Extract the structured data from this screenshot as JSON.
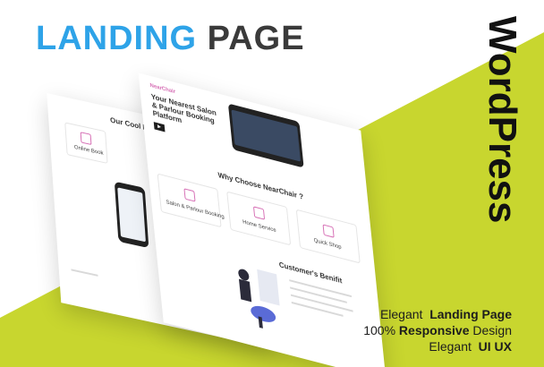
{
  "title": {
    "part1": "LANDING",
    "part2": "PAGE"
  },
  "side_label": "WordPress",
  "tagline": {
    "line1_a": "Elegant",
    "line1_b": "Landing Page",
    "line2_a": "100%",
    "line2_b": "Responsive",
    "line2_c": "Design",
    "line3_a": "Elegant",
    "line3_b": "UI UX"
  },
  "mockup": {
    "back_heading": "Our Cool Features",
    "back_card": "Online Book",
    "hero_title": "Your Nearest Salon & Parlour Booking Platform",
    "hero_brand": "NearChair",
    "why_heading": "Why Choose NearChair ?",
    "cards": [
      "Salon & Parlour Booking",
      "Home Service",
      "Quick Shop"
    ],
    "benefit_heading": "Customer's Benifit"
  },
  "colors": {
    "lime": "#c8d62f",
    "blue": "#2ea3e8",
    "dark": "#3a3a3a",
    "accent": "#d66fb5"
  }
}
